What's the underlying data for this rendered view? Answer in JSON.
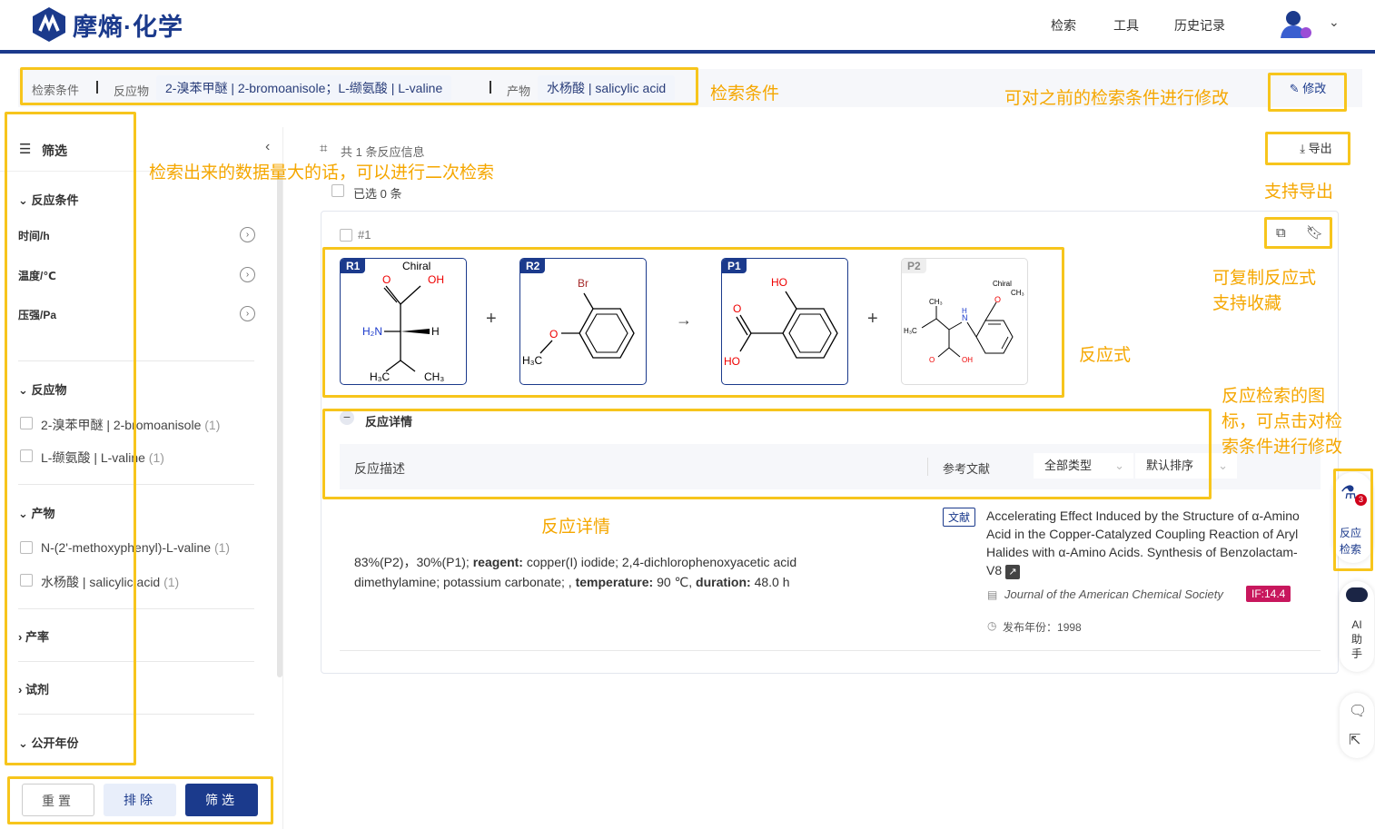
{
  "header": {
    "logo_text": "摩熵·化学",
    "nav": [
      "检索",
      "工具",
      "历史记录"
    ]
  },
  "search": {
    "label": "检索条件",
    "reactant_label": "反应物",
    "reactant_value": "2-溴苯甲醚 | 2-bromoanisole；L-缬氨酸 | L-valine",
    "product_label": "产物",
    "product_value": "水杨酸 | salicylic acid",
    "edit_label": "修改"
  },
  "sidebar": {
    "title": "筛选",
    "sections": {
      "conditions": "反应条件",
      "reactants": "反应物",
      "products": "产物",
      "yield": "产率",
      "reagent": "试剂",
      "year": "公开年份"
    },
    "conditions": [
      "时间/h",
      "温度/℃",
      "压强/Pa"
    ],
    "reactants": [
      {
        "label": "2-溴苯甲醚 | 2-bromoanisole",
        "count": "(1)"
      },
      {
        "label": "L-缬氨酸 | L-valine",
        "count": "(1)"
      }
    ],
    "products": [
      {
        "label": "N-(2'-methoxyphenyl)-L-valine",
        "count": "(1)"
      },
      {
        "label": "水杨酸 | salicylic acid",
        "count": "(1)"
      }
    ],
    "buttons": {
      "reset": "重置",
      "exclude": "排除",
      "filter": "筛选"
    }
  },
  "results": {
    "summary": "共 1 条反应信息",
    "selected": "已选 0 条",
    "export_label": "导出",
    "item_id": "#1",
    "molecules": [
      {
        "tag": "R1",
        "chiral": "Chiral"
      },
      {
        "tag": "R2"
      },
      {
        "tag": "P1"
      },
      {
        "tag": "P2",
        "chiral": "Chiral"
      }
    ],
    "plus": "+",
    "arrow": "→",
    "details_title": "反应详情",
    "desc_header": "反应描述",
    "ref_header": "参考文献",
    "type_select": "全部类型",
    "sort_select": "默认排序",
    "description": {
      "yields": "83%(P2)，30%(P1);",
      "reagent_label": "reagent:",
      "reagent": "copper(I) iodide; 2,4-dichlorophenoxyacetic acid dimethylamine; potassium carbonate; ,",
      "temperature_label": "temperature:",
      "temperature": "90 ℃,",
      "duration_label": "duration:",
      "duration": "48.0 h"
    },
    "reference": {
      "badge": "文献",
      "title": "Accelerating Effect Induced by the Structure of α-Amino Acid in the Copper-Catalyzed Coupling Reaction of Aryl Halides with α-Amino Acids. Synthesis of Benzolactam-V8",
      "journal": "Journal of the American Chemical Society",
      "impact": "IF:14.4",
      "year_label": "发布年份：",
      "year": "1998"
    }
  },
  "right_float": {
    "reaction_search": "反应检索",
    "badge": "3",
    "ai": "AI助手"
  },
  "annotations": {
    "search_conditions": "检索条件",
    "modify": "可对之前的检索条件进行修改",
    "secondary": "检索出来的数据量大的话，可以进行二次检索",
    "export": "支持导出",
    "copy": "可复制反应式",
    "favorite": "支持收藏",
    "equation": "反应式",
    "details": "反应详情",
    "icon_line1": "反应检索的图",
    "icon_line2": "标，可点击对检",
    "icon_line3": "索条件进行修改"
  },
  "colors": {
    "brand": "#1b3a8c",
    "annotation": "#f5a700",
    "impact": "#c8175d"
  }
}
